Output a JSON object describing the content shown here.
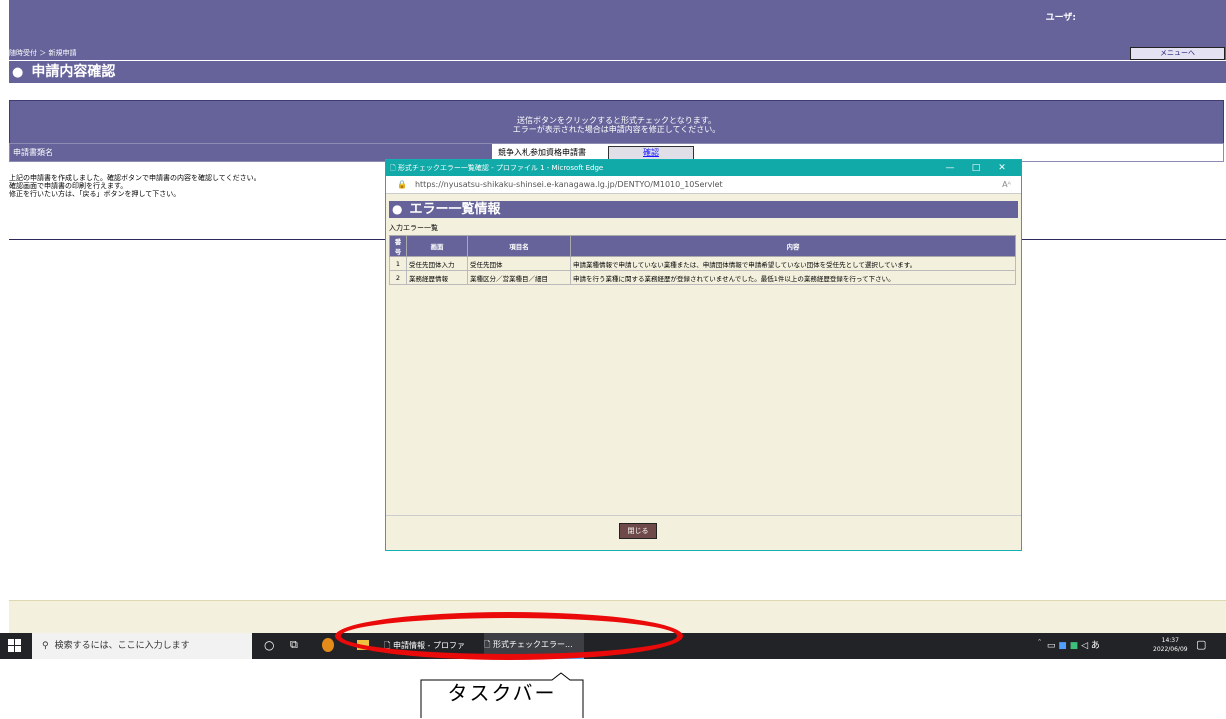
{
  "header": {
    "user_label": "ユーザ:",
    "breadcrumb": "随時受付 ＞ 新規申請",
    "menu_button": "メニューへ",
    "page_title": "申請内容確認"
  },
  "info": {
    "line1": "送信ボタンをクリックすると形式チェックとなります。",
    "line2": "エラーが表示された場合は申請内容を修正してください。"
  },
  "form": {
    "label": "申請書類名",
    "value": "競争入札参加資格申請書",
    "confirm_button": "確認"
  },
  "instructions": [
    "上記の申請書を作成しました。確認ボタンで申請書の内容を確認してください。",
    "確認画面で申請書の印刷を行えます。",
    "修正を行いたい方は、「戻る」ボタンを押して下さい。"
  ],
  "popup": {
    "window_title": "形式チェックエラー一覧確認 - プロファイル 1 - Microsoft Edge",
    "url": "https://nyusatsu-shikaku-shinsei.e-kanagawa.lg.jp/DENTYO/M1010_10Servlet",
    "heading": "エラー一覧情報",
    "list_caption": "入力エラー一覧",
    "columns": [
      "番号",
      "画面",
      "項目名",
      "内容"
    ],
    "rows": [
      {
        "no": "1",
        "screen": "受任先団体入力",
        "item": "受任先団体",
        "content": "申請業種情報で申請していない業種または、申請団体情報で申請希望していない団体を受任先として選択しています。"
      },
      {
        "no": "2",
        "screen": "業務経歴情報",
        "item": "業種区分／営業種目／細目",
        "content": "申請を行う業種に関する業務経歴が登録されていませんでした。最低1件以上の業務経歴登録を行って下さい。"
      }
    ],
    "close_button": "閉じる",
    "controls": [
      "—",
      "□",
      "✕"
    ]
  },
  "taskbar": {
    "search_placeholder": "検索するには、ここに入力します",
    "app1": "申請情報 - プロファイ...",
    "app2": "形式チェックエラー...",
    "time": "14:37",
    "date": "2022/06/09",
    "ime": "あ"
  },
  "annotation": {
    "label": "タスクバー",
    "color": "#ea0a0a"
  }
}
